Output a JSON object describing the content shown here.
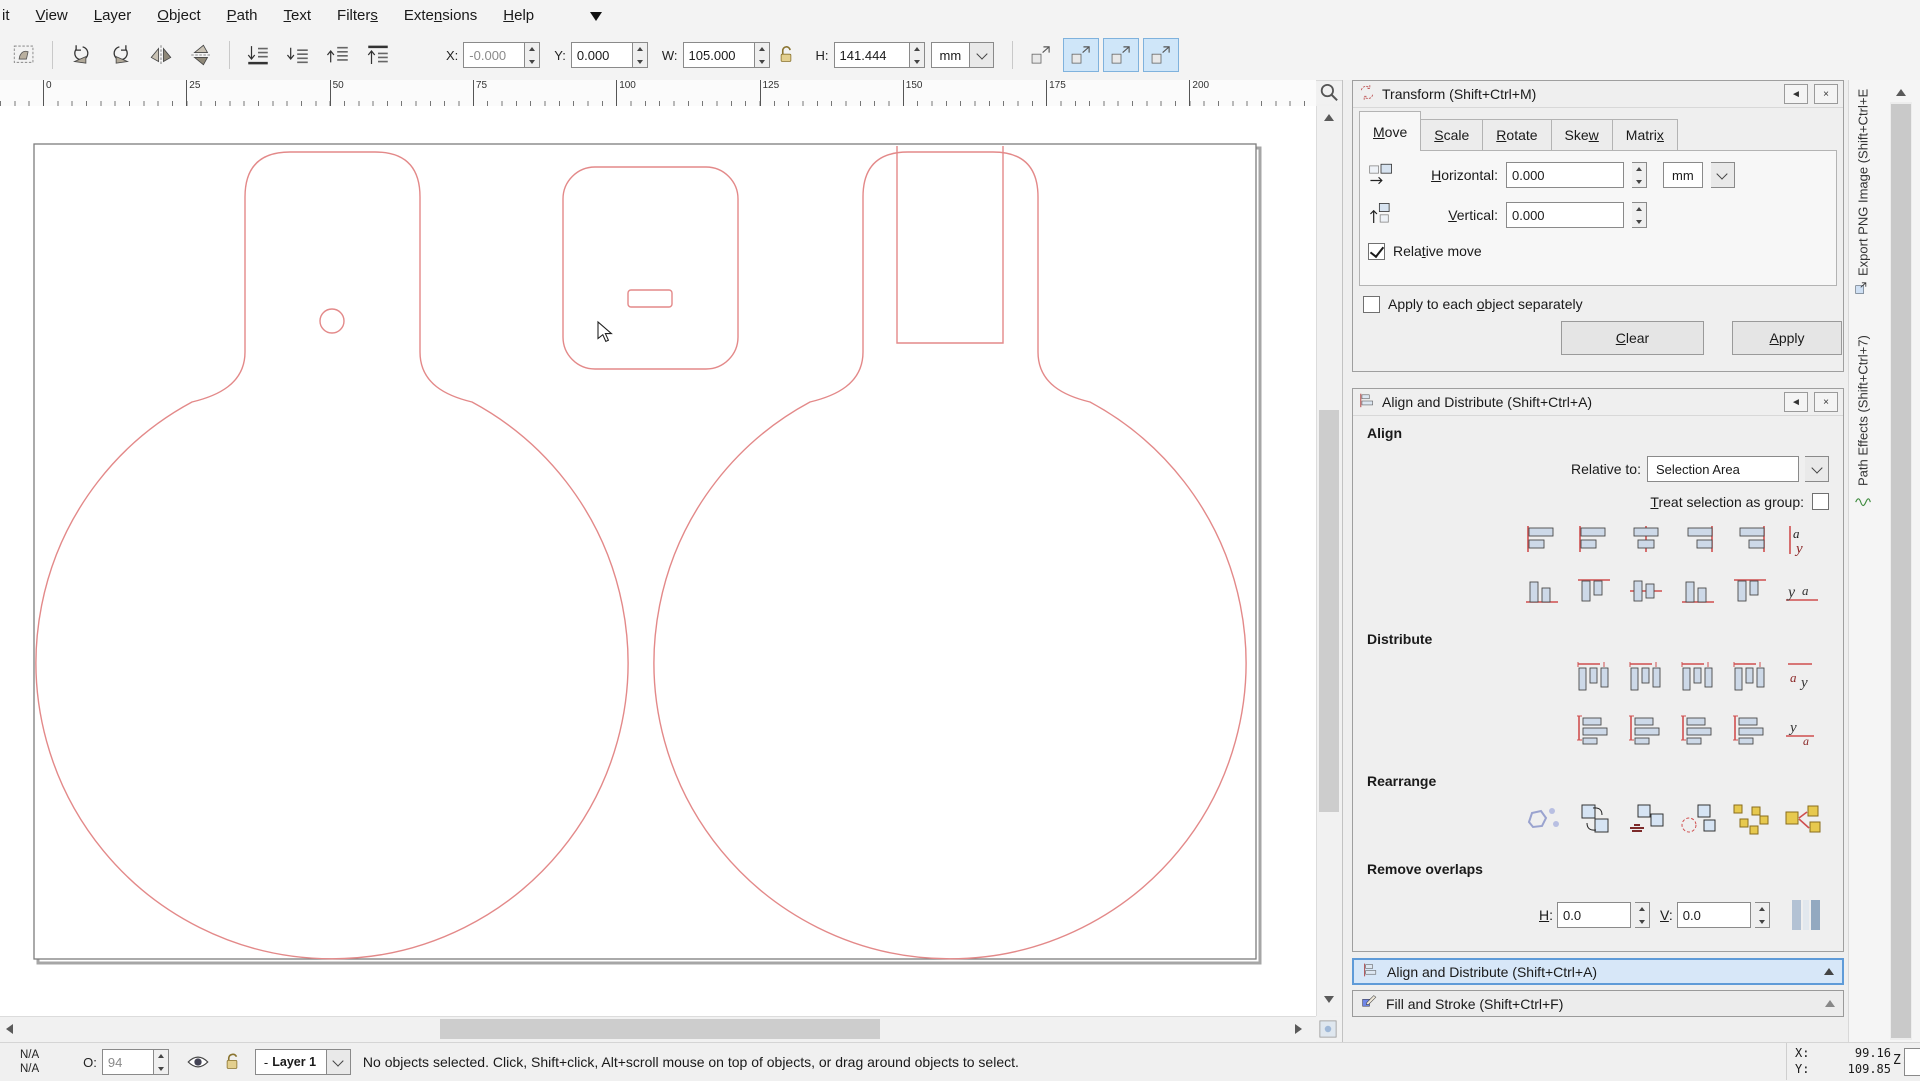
{
  "menu": {
    "items": [
      {
        "label": "it",
        "u": -1
      },
      {
        "label": "View",
        "u": 0
      },
      {
        "label": "Layer",
        "u": 0
      },
      {
        "label": "Object",
        "u": 0
      },
      {
        "label": "Path",
        "u": 0
      },
      {
        "label": "Text",
        "u": 0
      },
      {
        "label": "Filters",
        "u": 6
      },
      {
        "label": "Extensions",
        "u": 4
      },
      {
        "label": "Help",
        "u": 0
      }
    ]
  },
  "toolbar": {
    "x_label": "X:",
    "x_value": "-0.000",
    "y_label": "Y:",
    "y_value": "0.000",
    "w_label": "W:",
    "w_value": "105.000",
    "h_label": "H:",
    "h_value": "141.444",
    "unit_value": "mm"
  },
  "ruler": {
    "labels": [
      "0",
      "25",
      "50",
      "75",
      "100",
      "125",
      "150",
      "175",
      "200"
    ]
  },
  "transform_panel": {
    "title": "Transform (Shift+Ctrl+M)",
    "tabs": [
      {
        "label": "Move",
        "u": 0
      },
      {
        "label": "Scale",
        "u": 0
      },
      {
        "label": "Rotate",
        "u": 0
      },
      {
        "label": "Skew",
        "u": 3
      },
      {
        "label": "Matrix",
        "u": 5
      }
    ],
    "horizontal_label": "Horizontal:",
    "horizontal_value": "0.000",
    "unit_value": "mm",
    "vertical_label": "Vertical:",
    "vertical_value": "0.000",
    "relative_move_label": "Relative move",
    "apply_each_label": "Apply to each object separately",
    "clear_label": "Clear",
    "apply_label": "Apply"
  },
  "align_panel": {
    "title": "Align and Distribute (Shift+Ctrl+A)",
    "align_label": "Align",
    "relative_to_label": "Relative to:",
    "relative_to_value": "Selection Area",
    "treat_group_label": "Treat selection as group:",
    "distribute_label": "Distribute",
    "rearrange_label": "Rearrange",
    "remove_overlaps_label": "Remove overlaps",
    "h_label": "H:",
    "h_value": "0.0",
    "v_label": "V:",
    "v_value": "0.0",
    "align_icons": [
      {
        "name": "align-right-to-left-anchor-icon",
        "g": "alignL"
      },
      {
        "name": "align-left-edges-icon",
        "g": "alignL"
      },
      {
        "name": "center-on-vertical-axis-icon",
        "g": "alignC"
      },
      {
        "name": "align-right-edges-icon",
        "g": "alignR"
      },
      {
        "name": "align-left-to-right-anchor-icon",
        "g": "alignR"
      },
      {
        "name": "align-text-anchors-horizontal-icon",
        "g": "ay"
      },
      {
        "name": "align-bottom-to-top-anchor-icon",
        "g": "alignB"
      },
      {
        "name": "align-top-edges-icon",
        "g": "alignT"
      },
      {
        "name": "center-on-horizontal-axis-icon",
        "g": "alignM"
      },
      {
        "name": "align-bottom-edges-icon",
        "g": "alignB"
      },
      {
        "name": "align-top-to-bottom-anchor-icon",
        "g": "alignT"
      },
      {
        "name": "align-text-anchors-vertical-icon",
        "g": "ya"
      }
    ],
    "distribute_icons": [
      {
        "name": "distribute-left-edges-icon",
        "g": "dh"
      },
      {
        "name": "distribute-centers-horizontally-icon",
        "g": "dh"
      },
      {
        "name": "distribute-right-edges-icon",
        "g": "dh"
      },
      {
        "name": "make-horizontal-gaps-equal-icon",
        "g": "dh"
      },
      {
        "name": "distribute-text-anchors-horizontal-icon",
        "g": "day"
      },
      {
        "name": "distribute-top-edges-icon",
        "g": "dv"
      },
      {
        "name": "distribute-centers-vertically-icon",
        "g": "dv"
      },
      {
        "name": "distribute-bottom-edges-icon",
        "g": "dv"
      },
      {
        "name": "make-vertical-gaps-equal-icon",
        "g": "dv"
      },
      {
        "name": "distribute-text-anchors-vertical-icon",
        "g": "dya"
      }
    ],
    "rearrange_icons": [
      {
        "name": "graph-layout-icon",
        "g": "node"
      },
      {
        "name": "exchange-in-selection-order-icon",
        "g": "swap"
      },
      {
        "name": "exchange-in-stacking-order-icon",
        "g": "stackswap"
      },
      {
        "name": "exchange-clockwise-icon",
        "g": "rotswap"
      },
      {
        "name": "randomize-positions-icon",
        "g": "rand"
      },
      {
        "name": "unclump-icon",
        "g": "unclump"
      }
    ]
  },
  "collapsed_panels": [
    {
      "label": "Align and Distribute (Shift+Ctrl+A)",
      "icon": "align-collapsed-icon",
      "active": true
    },
    {
      "label": "Fill and Stroke (Shift+Ctrl+F)",
      "icon": "fill-stroke-collapsed-icon",
      "active": false
    }
  ],
  "side_tabs": [
    {
      "label": "Export PNG Image (Shift+Ctrl+E",
      "icon": "export-png-tab-icon"
    },
    {
      "label": "Path Effects  (Shift+Ctrl+7)",
      "icon": "path-effects-tab-icon"
    }
  ],
  "status_bar": {
    "fill_value": "N/A",
    "stroke_value": "N/A",
    "opacity_label": "O:",
    "opacity_value": "94",
    "layer_dash": "-",
    "layer_value": "Layer 1",
    "message": "No objects selected. Click, Shift+click, Alt+scroll mouse on top of objects, or drag around objects to select.",
    "x_label": "X:",
    "x_value": "99.16",
    "y_label": "Y:",
    "y_value": "109.85",
    "z_label": "Z:"
  },
  "icons": {
    "selection-settings-icon": "sel",
    "rotate-ccw-icon": "rotl",
    "rotate-cw-icon": "rotr",
    "flip-horizontal-icon": "fliph",
    "flip-vertical-icon": "flipv",
    "lower-to-bottom-icon": "lowbot",
    "lower-one-step-icon": "low",
    "raise-one-step-icon": "raise",
    "raise-to-top-icon": "raistop",
    "lock-width-height-icon": "lock",
    "scale-stroke-toggle-icon": "tgl",
    "scale-corners-toggle-icon": "tgl",
    "move-gradients-toggle-icon": "tgl",
    "move-patterns-toggle-icon": "tgl",
    "transform-dialog-icon": "thdr",
    "align-dialog-icon": "ahdr",
    "align-collapsed-icon": "ahdr",
    "fill-stroke-collapsed-icon": "fshdr",
    "move-horizontal-icon": "movh",
    "move-vertical-icon": "movv",
    "layer-visibility-eye-icon": "eye",
    "layer-lock-icon": "lopen",
    "zoom-drawing-icon": "mag",
    "canvas-corner-icon": "corner",
    "export-png-tab-icon": "exptab",
    "path-effects-tab-icon": "pfxtab",
    "remove-overlaps-icon": "removebtn"
  },
  "colors": {
    "outline_red": "#e38989",
    "active_toggle_blue": "#cfe6f9",
    "selected_bar_blue": "#d7e7f8"
  }
}
